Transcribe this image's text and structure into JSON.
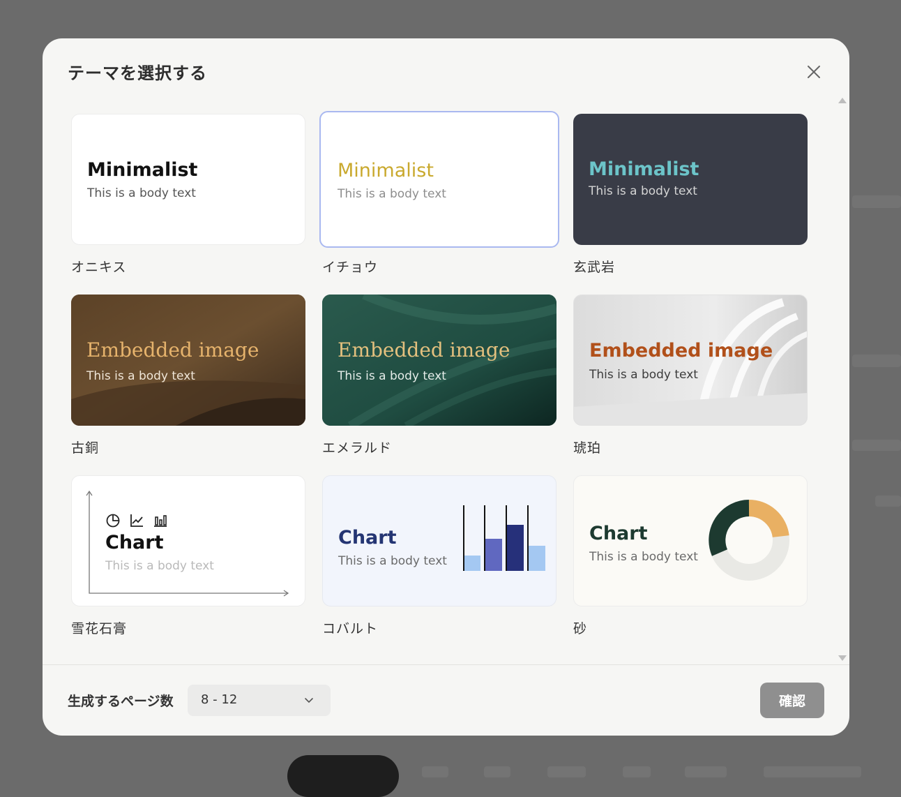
{
  "dialog": {
    "title": "テーマを選択する",
    "close_icon": "close-icon"
  },
  "themes": [
    {
      "name": "オニキス",
      "heading": "Minimalist",
      "body": "This is a body text",
      "bg": "#ffffff",
      "heading_color": "#111111",
      "body_color": "#555555"
    },
    {
      "name": "イチョウ",
      "heading": "Minimalist",
      "body": "This is a body text",
      "bg": "#ffffff",
      "heading_color": "#c9a92e",
      "body_color": "#8d8d8d",
      "selected": true,
      "selected_border": "#a9b8f0"
    },
    {
      "name": "玄武岩",
      "heading": "Minimalist",
      "body": "This is a body text",
      "bg": "#393c47",
      "heading_color": "#6cc4c9",
      "body_color": "#d4d4d4"
    },
    {
      "name": "古銅",
      "heading": "Embedded image",
      "body": "This is a body text",
      "bg": "#5a4430",
      "heading_color": "#e6b36c",
      "body_color": "#f0e6d8"
    },
    {
      "name": "エメラルド",
      "heading": "Embedded image",
      "body": "This is a body text",
      "bg": "#1f4a40",
      "heading_color": "#e3c07e",
      "body_color": "#e4ece8"
    },
    {
      "name": "琥珀",
      "heading": "Embedded image",
      "body": "This is a body text",
      "bg": "#e8e8e8",
      "heading_color": "#b1501a",
      "body_color": "#3c3c3c"
    },
    {
      "name": "雪花石膏",
      "heading": "Chart",
      "body": "This is a body text",
      "bg": "#ffffff",
      "heading_color": "#111111",
      "body_color": "#b9b9b9"
    },
    {
      "name": "コバルト",
      "heading": "Chart",
      "body": "This is a body text",
      "bg": "#f2f5fc",
      "heading_color": "#243573",
      "body_color": "#6a6a6a"
    },
    {
      "name": "砂",
      "heading": "Chart",
      "body": "This is a body text",
      "bg": "#fbfaf6",
      "heading_color": "#1d3a30",
      "body_color": "#6a6a6a"
    }
  ],
  "footer": {
    "pages_label": "生成するページ数",
    "pages_value": "8 - 12",
    "confirm_label": "確認"
  }
}
